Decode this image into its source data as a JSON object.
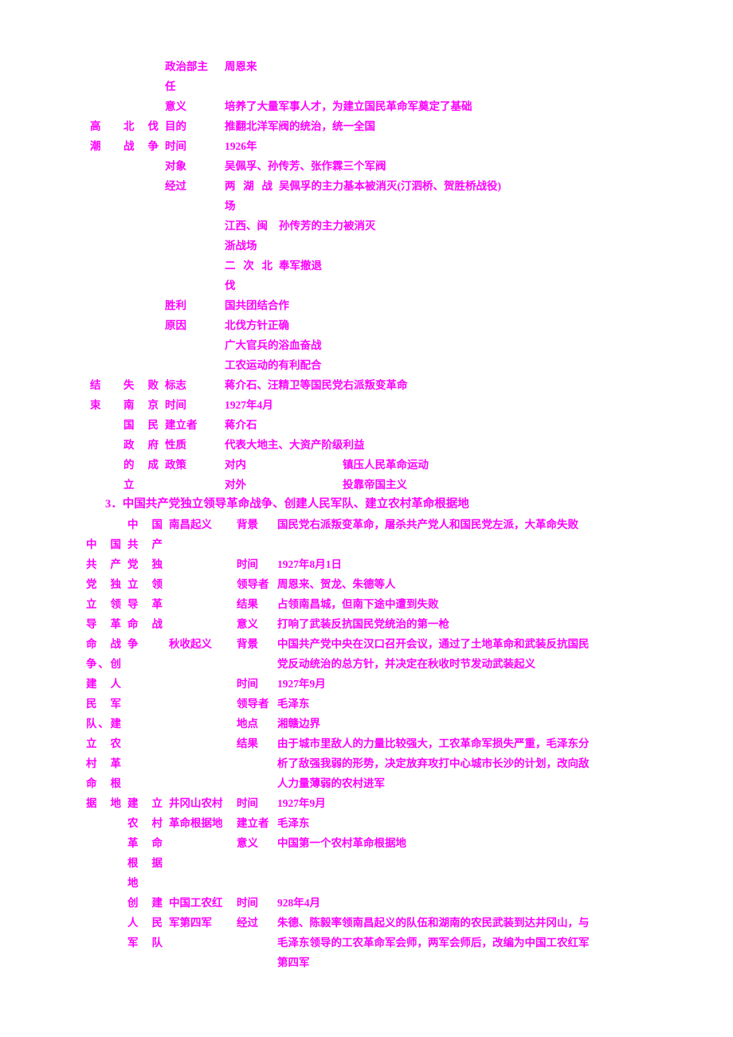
{
  "document": {
    "text_color": "#ff00ff",
    "background_color": "#ffffff"
  },
  "section_heading": "3．中国共产党独立领导革命战争、创建人民军队、建立农村革命根据地",
  "table_top": {
    "col0_label_lines": [
      "高",
      "潮"
    ],
    "col1_label_lines": [
      "北 伐",
      "战 争"
    ],
    "rows": [
      {
        "label": "政治部主",
        "value": "周恩来"
      },
      {
        "label": "任",
        "value": ""
      },
      {
        "label": "意义",
        "value": "培养了大量军事人才，为建立国民革命军奠定了基础"
      },
      {
        "label": "目的",
        "value": "推翻北洋军阀的统治，统一全国"
      },
      {
        "label": "时间",
        "value": "1926年"
      },
      {
        "label": "对象",
        "value": "吴佩孚、孙传芳、张作霖三个军阀"
      },
      {
        "label": "经过",
        "sub": "两 湖 战",
        "value": "吴佩孚的主力基本被消灭(汀泗桥、贺胜桥战役)"
      },
      {
        "label": "",
        "sub": "场",
        "value": ""
      },
      {
        "label": "",
        "sub": "江西、闽",
        "value": "孙传芳的主力被消灭"
      },
      {
        "label": "",
        "sub": "浙战场",
        "value": ""
      },
      {
        "label": "",
        "sub": "二 次 北",
        "value": "奉军撤退"
      },
      {
        "label": "",
        "sub": "伐",
        "value": ""
      },
      {
        "label": "胜利",
        "value": "国共团结合作"
      },
      {
        "label": "原因",
        "value": "北伐方针正确"
      },
      {
        "label": "",
        "value": "广大官兵的浴血奋战"
      },
      {
        "label": "",
        "value": "工农运动的有利配合"
      }
    ]
  },
  "table_end": {
    "col0_label_lines": [
      "结",
      "束"
    ],
    "col1_label_lines": [
      "失败",
      "南 京",
      "国 民",
      "政 府",
      "的 成",
      "立"
    ],
    "rows": [
      {
        "label": "标志",
        "value": "蒋介石、汪精卫等国民党右派叛变革命"
      },
      {
        "label": "时间",
        "value": "1927年4月"
      },
      {
        "label": "建立者",
        "value": "蒋介石"
      },
      {
        "label": "性质",
        "value": "代表大地主、大资产阶级利益"
      },
      {
        "label": "政策",
        "sub": "对内",
        "value": "镇压人民革命运动"
      },
      {
        "label": "",
        "sub": "对外",
        "value": "投靠帝国主义"
      }
    ]
  },
  "table_bottom": {
    "col0_label": "中国共产党独立领导革命战争、创建人民军队、建立农村革命根据地",
    "col0_label_lines": [
      "中 国",
      "共 产",
      "党 独",
      "立 领",
      "导 革",
      "命 战",
      "争、创",
      "建 人",
      "民 军",
      "队、建",
      "立 农",
      "村 革",
      "命 根",
      "据地"
    ],
    "groups": [
      {
        "group_label_lines": [
          "中 国",
          "共 产",
          "党 独",
          "立 领",
          "导 革",
          "命 战",
          "争"
        ],
        "topic": "南昌起义",
        "rows": [
          {
            "label": "背景",
            "value": "国民党右派叛变革命，屠杀共产党人和国民党左派，大革命失败"
          },
          {
            "label": "时间",
            "value": "1927年8月1日"
          },
          {
            "label": "领导者",
            "value": "周恩来、贺龙、朱德等人"
          },
          {
            "label": "结果",
            "value": "占领南昌城，但南下途中遭到失败"
          },
          {
            "label": "意义",
            "value": "打响了武装反抗国民党统治的第一枪"
          }
        ]
      },
      {
        "group_label_lines": [],
        "topic": "秋收起义",
        "rows": [
          {
            "label": "背景",
            "value": "中国共产党中央在汉口召开会议，通过了土地革命和武装反抗国民党反动统治的总方针，并决定在秋收时节发动武装起义"
          },
          {
            "label": "时间",
            "value": "1927年9月"
          },
          {
            "label": "领导者",
            "value": "毛泽东"
          },
          {
            "label": "地点",
            "value": "湘赣边界"
          },
          {
            "label": "结果",
            "value": "由于城市里敌人的力量比较强大，工农革命军损失严重，毛泽东分析了敌强我弱的形势，决定放弃攻打中心城市长沙的计划，改向敌人力量薄弱的农村进军"
          }
        ]
      },
      {
        "group_label_lines": [
          "建 立",
          "农 村",
          "革 命",
          "根 据",
          "地"
        ],
        "topic_lines": [
          "井冈山农村",
          "革命根据地"
        ],
        "rows": [
          {
            "label": "时间",
            "value": "1927年9月"
          },
          {
            "label": "建立者",
            "value": "毛泽东"
          },
          {
            "label": "意义",
            "value": "中国第一个农村革命根据地"
          }
        ]
      },
      {
        "group_label_lines": [
          "创 建",
          "人 民",
          "军队"
        ],
        "topic_lines": [
          "中国工农红",
          "军第四军"
        ],
        "rows": [
          {
            "label": "时间",
            "value": "928年4月"
          },
          {
            "label": "经过",
            "value": "朱德、陈毅率领南昌起义的队伍和湖南的农民武装到达井冈山，与毛泽东领导的工农革命军会师，两军会师后，改编为中国工农红军第四军"
          }
        ]
      }
    ]
  }
}
